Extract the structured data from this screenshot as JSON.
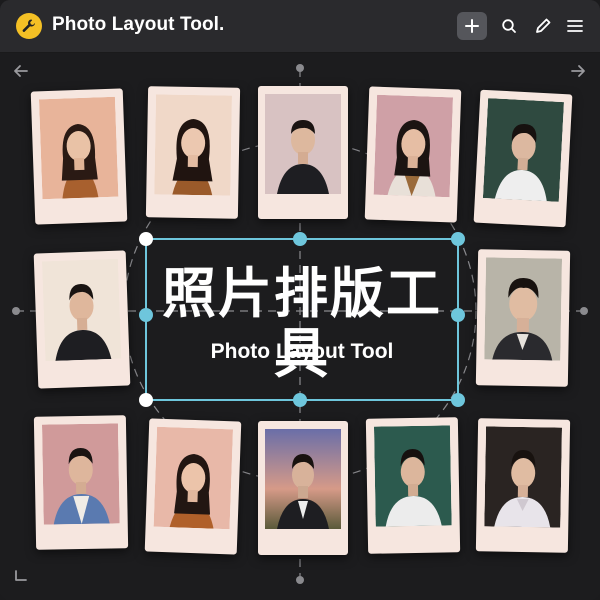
{
  "app": {
    "title": "Photo Layout Tool.",
    "logo_icon": "wrench-icon",
    "accent_color": "#f4c025"
  },
  "toolbar": {
    "buttons": [
      "add-icon",
      "search-icon",
      "pen-icon",
      "menu-icon"
    ]
  },
  "canvas": {
    "nav": [
      "arrow-left-icon",
      "arrow-right-icon",
      "corner-icon"
    ],
    "selection_color": "#6ec6dc",
    "title_cn": "照片排版工具",
    "title_en": "Photo Layout Tool"
  },
  "photos": [
    {
      "row": 1,
      "subject": "woman",
      "background": "#e8b49a",
      "top_wear": "#a8602e"
    },
    {
      "row": 1,
      "subject": "woman",
      "background": "#f0d8c8",
      "top_wear": "#9a5a2a"
    },
    {
      "row": 1,
      "subject": "man",
      "background": "#d8c2c2",
      "top_wear": "#1e1e22"
    },
    {
      "row": 1,
      "subject": "woman",
      "background": "#cfa0a6",
      "top_wear": "#e8e0d8"
    },
    {
      "row": 1,
      "subject": "man",
      "background": "#2f4a40",
      "top_wear": "#eeeeee"
    },
    {
      "row": 2,
      "subject": "man",
      "background": "#f0e4d8",
      "top_wear": "#1e1e22"
    },
    {
      "row": 2,
      "subject": "man",
      "background": "#b8b4a8",
      "top_wear": "#2a2a2e"
    },
    {
      "row": 3,
      "subject": "man",
      "background": "#d09a9a",
      "top_wear": "#5a7ab0"
    },
    {
      "row": 3,
      "subject": "woman",
      "background": "#e8b8a8",
      "top_wear": "#b0602a"
    },
    {
      "row": 3,
      "subject": "man",
      "background": "#7a7aa8",
      "top_wear": "#1e1e22"
    },
    {
      "row": 3,
      "subject": "man",
      "background": "#2c5a4e",
      "top_wear": "#ececec"
    },
    {
      "row": 3,
      "subject": "man",
      "background": "#2a2422",
      "top_wear": "#e8e4ea"
    }
  ]
}
